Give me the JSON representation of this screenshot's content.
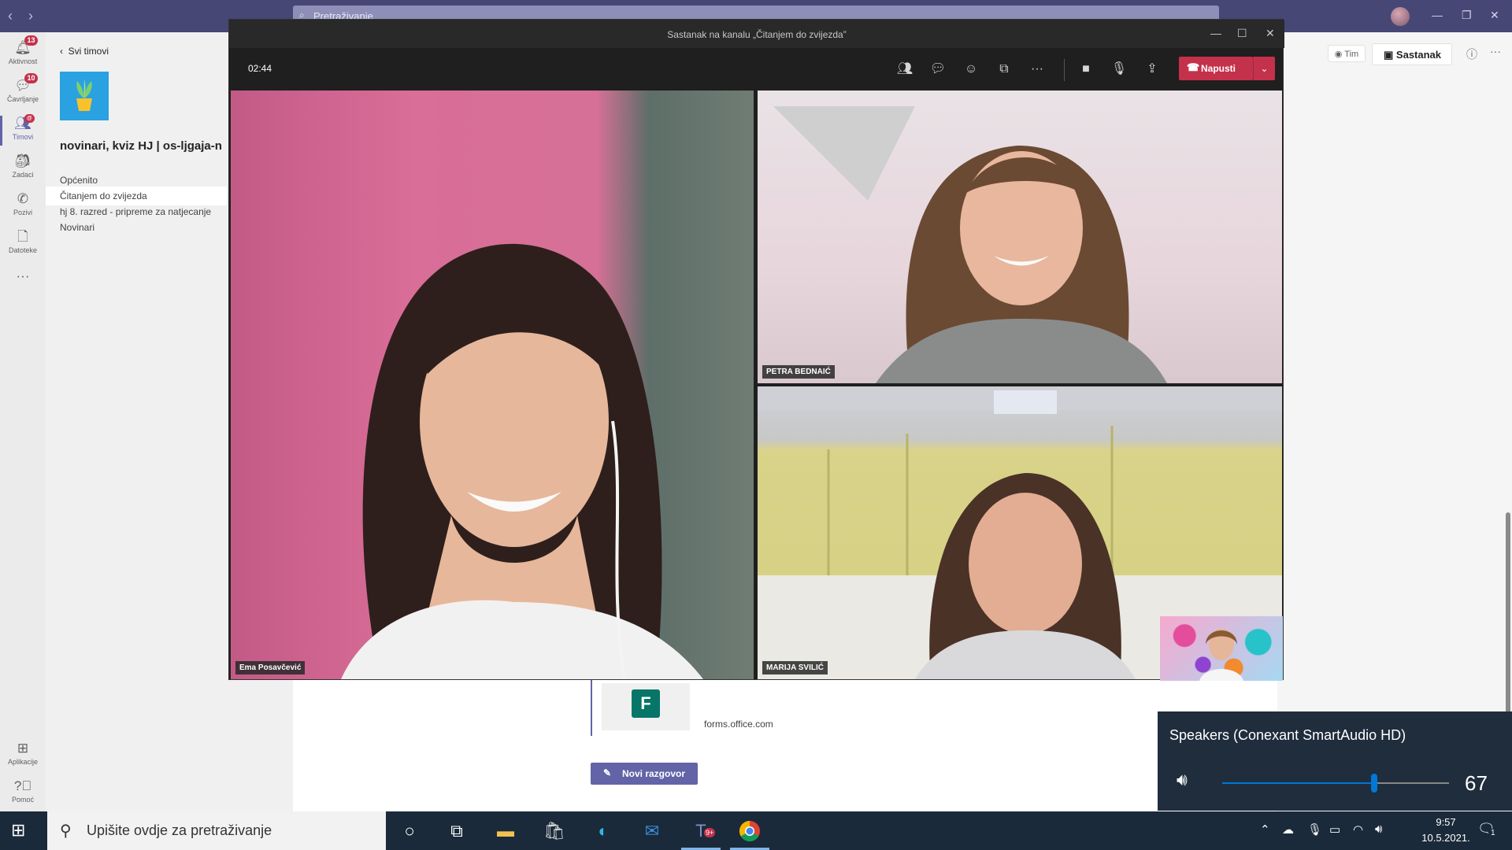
{
  "teams": {
    "search_placeholder": "Pretraživanje",
    "rail": [
      {
        "label": "Aktivnost",
        "badge": "13",
        "icon": "bell-icon"
      },
      {
        "label": "Čavrljanje",
        "badge": "10",
        "icon": "chat-icon"
      },
      {
        "label": "Timovi",
        "badge": "@",
        "icon": "teams-icon"
      },
      {
        "label": "Zadaci",
        "badge": "",
        "icon": "assignments-icon"
      },
      {
        "label": "Pozivi",
        "badge": "",
        "icon": "phone-icon"
      },
      {
        "label": "Datoteke",
        "badge": "",
        "icon": "files-icon"
      },
      {
        "label": "Aplikacije",
        "badge": "",
        "icon": "apps-icon"
      },
      {
        "label": "Pomoć",
        "badge": "",
        "icon": "help-icon"
      }
    ],
    "back_label": "Svi timovi",
    "team_name": "novinari, kviz HJ | os-ljgaja-n",
    "channels": [
      "Općenito",
      "Čitanjem do zvijezda",
      "hj 8. razred - pripreme za natjecanje",
      "Novinari"
    ],
    "active_channel_index": 1,
    "header_tim": "Tim",
    "header_meeting": "Sastanak",
    "card_url": "forms.office.com",
    "new_conversation": "Novi razgovor"
  },
  "meeting": {
    "title": "Sastanak na kanalu „Čitanjem do zvijezda”",
    "timer": "02:44",
    "leave_label": "Napusti",
    "participants": [
      "Ema Posavčević",
      "PETRA BEDNAIĆ",
      "MARIJA SVILIĆ"
    ]
  },
  "volume": {
    "device": "Speakers (Conexant SmartAudio HD)",
    "level": 67
  },
  "taskbar": {
    "search_placeholder": "Upišite ovdje za pretraživanje",
    "time": "9:57",
    "date": "10.5.2021.",
    "teams_badge": "9+",
    "notification_count": "1"
  },
  "colors": {
    "teams_purple": "#464775",
    "accent": "#6264a7",
    "leave_red": "#c4314b",
    "volume_blue": "#0078d7"
  }
}
